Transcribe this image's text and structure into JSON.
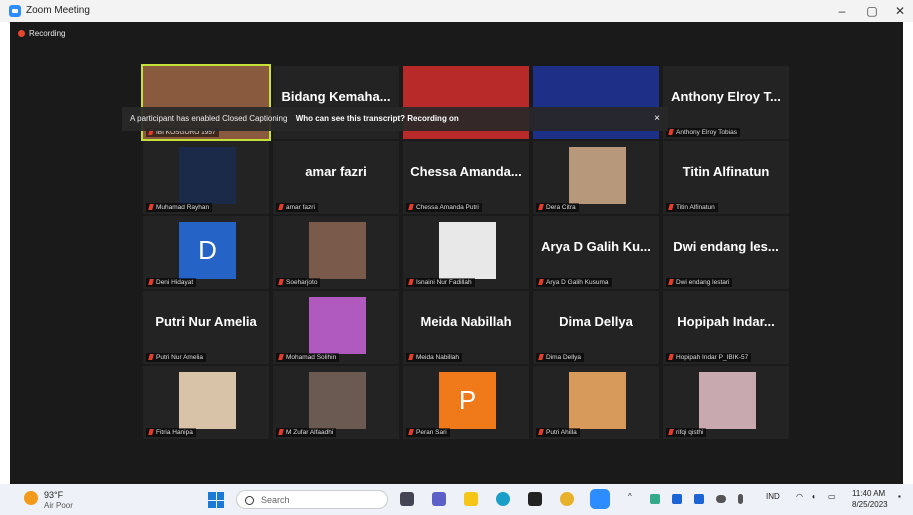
{
  "window": {
    "title": "Zoom Meeting",
    "min": "–",
    "restore": "▢",
    "close": "✕"
  },
  "recording": {
    "label": "Recording"
  },
  "caption_banner": {
    "text": "A participant has enabled Closed Captioning",
    "link": "Who can see this transcript? Recording on",
    "close": "×"
  },
  "tiles": [
    {
      "big": "",
      "label": "IBI KOSGORO 1957",
      "type": "video",
      "color": "#8a5a3e",
      "active": true
    },
    {
      "big": "Bidang Kemaha...",
      "label": "",
      "type": "name"
    },
    {
      "big": "",
      "label": "",
      "type": "video",
      "color": "#b82a2a"
    },
    {
      "big": "",
      "label": "",
      "type": "video",
      "color": "#1d2f86"
    },
    {
      "big": "Anthony Elroy T...",
      "label": "Anthony Elroy Tobias",
      "type": "name"
    },
    {
      "big": "",
      "label": "Muhamad Rayhan",
      "type": "video",
      "color": "#1c2a4a"
    },
    {
      "big": "amar fazri",
      "label": "amar fazri",
      "type": "name"
    },
    {
      "big": "Chessa Amanda...",
      "label": "Chessa Amanda Putri",
      "type": "name"
    },
    {
      "big": "",
      "label": "Dera Citra",
      "type": "video",
      "color": "#b7987a"
    },
    {
      "big": "Titin Alfinatun",
      "label": "Titin Alfinatun",
      "type": "name"
    },
    {
      "big": "",
      "label": "Deni Hidayat",
      "type": "letter",
      "letter": "D",
      "color": "#2563c7"
    },
    {
      "big": "",
      "label": "Soeharjoto",
      "type": "video",
      "color": "#7a5a4a"
    },
    {
      "big": "",
      "label": "Isnaini Nur Fadillah",
      "type": "video",
      "color": "#e8e8e8"
    },
    {
      "big": "Arya D Galih Ku...",
      "label": "Arya D Galih Kusuma",
      "type": "name"
    },
    {
      "big": "Dwi endang les...",
      "label": "Dwi endang lestari",
      "type": "name"
    },
    {
      "big": "Putri Nur Amelia",
      "label": "Putri Nur Amelia",
      "type": "name"
    },
    {
      "big": "",
      "label": "Mohamad Solihin",
      "type": "video",
      "color": "#b05ac0"
    },
    {
      "big": "Meida Nabillah",
      "label": "Meida Nabillah",
      "type": "name"
    },
    {
      "big": "Dima Dellya",
      "label": "Dima Dellya",
      "type": "name"
    },
    {
      "big": "Hopipah Indar...",
      "label": "Hopipah Indar P_IBIK-57",
      "type": "name"
    },
    {
      "big": "",
      "label": "Fitria Hanipa",
      "type": "video",
      "color": "#d9c3a8"
    },
    {
      "big": "",
      "label": "M Zufar Alfaadhi",
      "type": "video",
      "color": "#6b5a52"
    },
    {
      "big": "",
      "label": "Peran Sari",
      "type": "letter",
      "letter": "P",
      "color": "#f07a1a"
    },
    {
      "big": "",
      "label": "Putri Ahilla",
      "type": "video",
      "color": "#d89a5a"
    },
    {
      "big": "",
      "label": "rifqi qisthi",
      "type": "video",
      "color": "#c9a9b0"
    }
  ],
  "taskbar": {
    "weather_temp": "93°F",
    "weather_desc": "Air Poor",
    "search_placeholder": "Search",
    "lang": "IND",
    "time": "11:40 AM",
    "date": "8/25/2023"
  }
}
